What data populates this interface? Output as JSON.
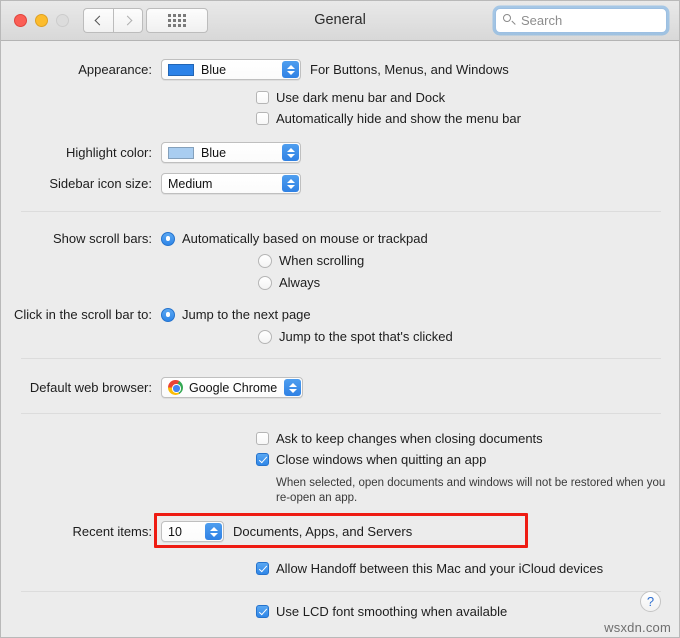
{
  "titlebar": {
    "title": "General",
    "back_icon": "chevron-left-icon",
    "forward_icon": "chevron-right-icon",
    "grid_icon": "grid-dots-icon",
    "search": {
      "placeholder": "Search",
      "value": "",
      "icon": "search-icon"
    },
    "traffic_lights": {
      "close": "close-button",
      "minimize": "minimize-button",
      "zoom": "zoom-button"
    }
  },
  "appearance": {
    "label": "Appearance:",
    "value": "Blue",
    "swatch_color": "#2b82e8",
    "trailing": "For Buttons, Menus, and Windows",
    "dark_menu_bar": {
      "label": "Use dark menu bar and Dock",
      "checked": false
    },
    "auto_hide_menu_bar": {
      "label": "Automatically hide and show the menu bar",
      "checked": false
    }
  },
  "highlight_color": {
    "label": "Highlight color:",
    "value": "Blue",
    "swatch_color": "#a9cdf0"
  },
  "sidebar_icon_size": {
    "label": "Sidebar icon size:",
    "value": "Medium"
  },
  "scroll_bars": {
    "label": "Show scroll bars:",
    "options": [
      {
        "label": "Automatically based on mouse or trackpad",
        "selected": true
      },
      {
        "label": "When scrolling",
        "selected": false
      },
      {
        "label": "Always",
        "selected": false
      }
    ]
  },
  "scroll_bar_click": {
    "label": "Click in the scroll bar to:",
    "options": [
      {
        "label": "Jump to the next page",
        "selected": true
      },
      {
        "label": "Jump to the spot that's clicked",
        "selected": false
      }
    ]
  },
  "default_browser": {
    "label": "Default web browser:",
    "value": "Google Chrome",
    "icon": "chrome-icon"
  },
  "documents": {
    "ask_keep_changes": {
      "label": "Ask to keep changes when closing documents",
      "checked": false
    },
    "close_windows": {
      "label": "Close windows when quitting an app",
      "checked": true
    },
    "close_windows_hint": "When selected, open documents and windows will not be restored when you re-open an app."
  },
  "recent_items": {
    "label": "Recent items:",
    "value": "10",
    "trailing": "Documents, Apps, and Servers",
    "highlighted": true,
    "highlight_color": "#ee1b12"
  },
  "handoff": {
    "label": "Allow Handoff between this Mac and your iCloud devices",
    "checked": true
  },
  "lcd_font_smoothing": {
    "label": "Use LCD font smoothing when available",
    "checked": true
  },
  "help_button": {
    "label": "?"
  },
  "watermark": {
    "text": "wsxdn.com"
  }
}
